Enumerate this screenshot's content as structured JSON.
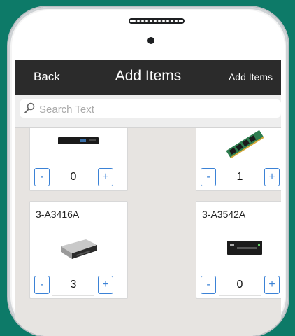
{
  "navbar": {
    "back_label": "Back",
    "title": "Add Items",
    "right_label": "Add Items"
  },
  "search": {
    "placeholder": "Search Text"
  },
  "items": [
    {
      "code": "",
      "image": "ups-rack-unit-image",
      "quantity": "0"
    },
    {
      "code": "",
      "image": "ram-module-image",
      "quantity": "1"
    },
    {
      "code": "3-A3416A",
      "image": "optical-drive-image",
      "quantity": "3"
    },
    {
      "code": "3-A3542A",
      "image": "tape-drive-image",
      "quantity": "0"
    }
  ],
  "stepper": {
    "minus_label": "-",
    "plus_label": "+"
  },
  "colors": {
    "background": "#0d7a68",
    "navbar": "#2b2b2b",
    "accent": "#3b82d6"
  }
}
